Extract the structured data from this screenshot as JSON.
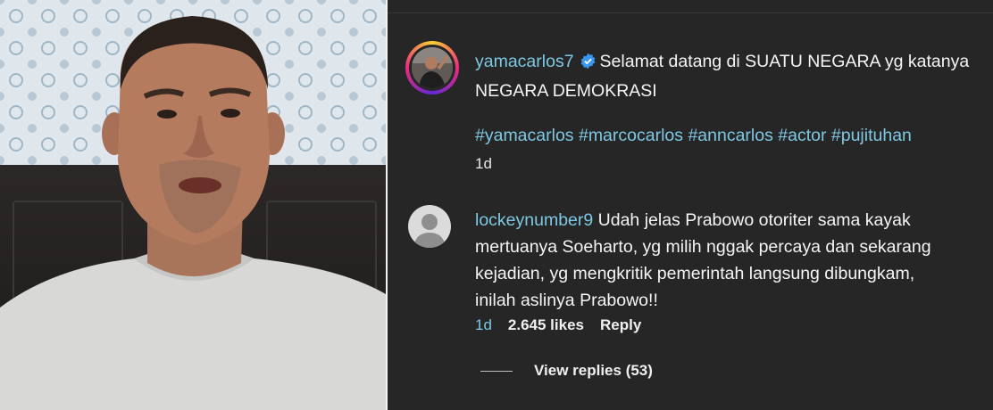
{
  "post": {
    "username": "yamacarlos7",
    "caption_line1": "Selamat datang di SUATU NEGARA yg katanya",
    "caption_line2": "NEGARA DEMOKRASI",
    "hashtags": [
      "#yamacarlos",
      "#marcocarlos",
      "#anncarlos",
      "#actor",
      "#pujituhan"
    ],
    "time": "1d"
  },
  "comment": {
    "username": "lockeynumber9",
    "line1": "Udah jelas Prabowo otoriter sama kayak",
    "line2": "mertuanya Soeharto, yg milih nggak percaya dan sekarang",
    "line3": "kejadian, yg mengkritik pemerintah langsung dibungkam,",
    "line4": "inilah aslinya Prabowo!!",
    "time": "1d",
    "likes": "2.645 likes",
    "reply_label": "Reply",
    "view_replies": "View replies (53)"
  },
  "colors": {
    "background": "#262626",
    "link": "#7ec8e3",
    "verified": "#3897f0"
  },
  "icons": [
    "verified-badge-icon",
    "default-avatar-icon"
  ]
}
